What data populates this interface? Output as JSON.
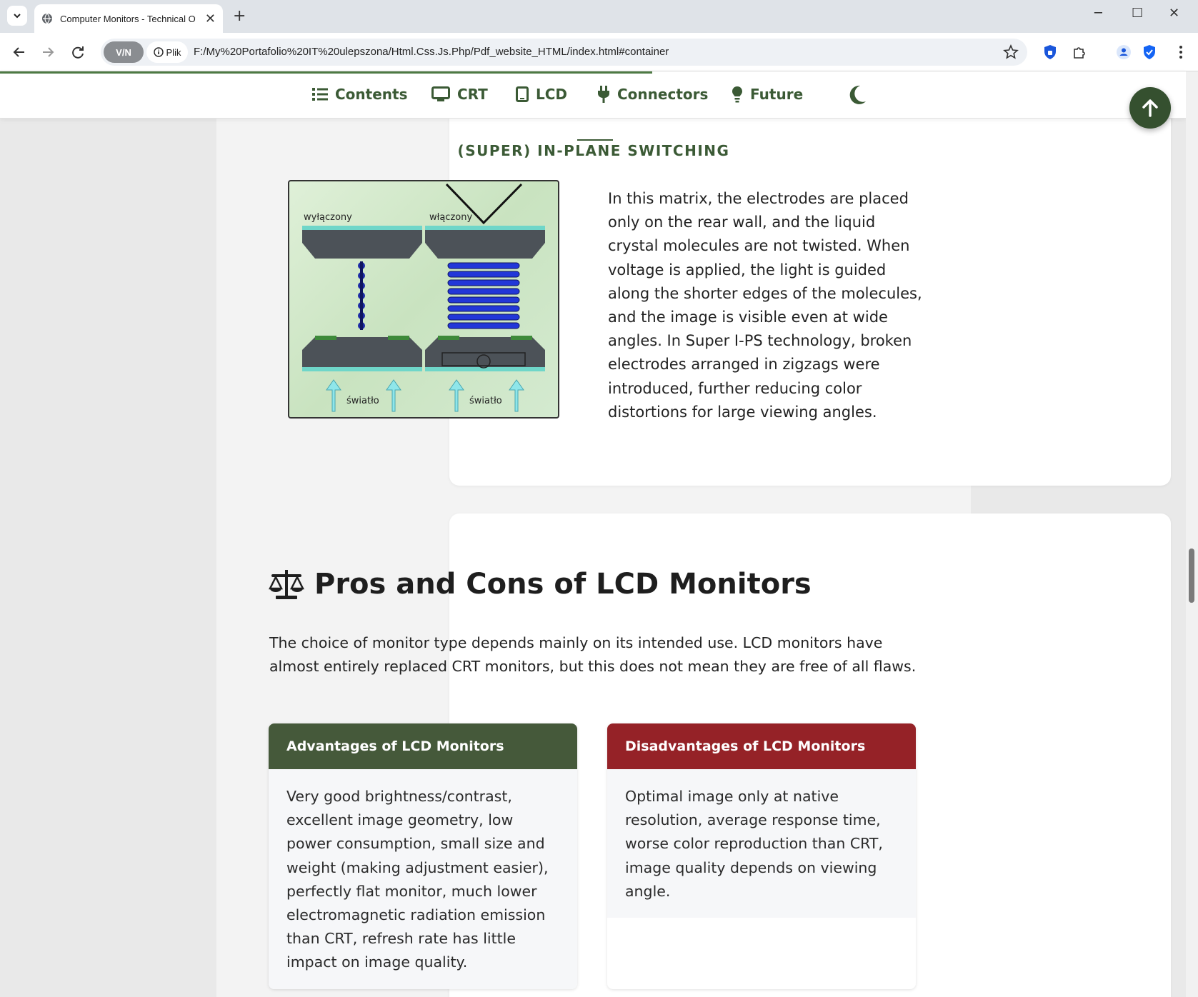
{
  "browser": {
    "tab_title": "Computer Monitors - Technical Ov",
    "vpn_label": "V/N",
    "site_info_label": "Plik",
    "url": "F:/My%20Portafolio%20IT%20ulepszona/Html.Css.Js.Php/Pdf_website_HTML/index.html#container",
    "icons": [
      "tab-list-icon",
      "globe-icon",
      "close-icon",
      "plus-icon",
      "minimize-icon",
      "maximize-icon",
      "close-window-icon",
      "back-icon",
      "forward-icon",
      "reload-icon",
      "info-icon",
      "star-icon",
      "shield-icon",
      "puzzle-icon",
      "profile-icon",
      "check-shield-icon",
      "menu-icon"
    ]
  },
  "nav": {
    "items": [
      {
        "label": "Contents",
        "icon": "list-icon"
      },
      {
        "label": "CRT",
        "icon": "monitor-icon"
      },
      {
        "label": "LCD",
        "icon": "tablet-icon"
      },
      {
        "label": "Connectors",
        "icon": "plug-icon"
      },
      {
        "label": "Future",
        "icon": "lightbulb-icon"
      }
    ],
    "theme_toggle_icon": "moon-icon",
    "back_to_top_icon": "arrow-up-icon",
    "accent_color": "#3b5a35",
    "reading_progress": 0.55
  },
  "ips": {
    "title": "(SUPER) IN-PLANE SWITCHING",
    "figure_labels": {
      "off": "wyłączony",
      "on": "włączony",
      "light_left": "światło",
      "light_right": "światło"
    },
    "description": "In this matrix, the electrodes are placed only on the rear wall, and the liquid crystal molecules are not twisted. When voltage is applied, the light is guided along the shorter edges of the molecules, and the image is visible even at wide angles. In Super I-PS technology, broken electrodes arranged in zigzags were introduced, further reducing color distortions for large viewing angles."
  },
  "pros_cons": {
    "heading": "Pros and Cons of LCD Monitors",
    "heading_icon": "scale-icon",
    "intro": "The choice of monitor type depends mainly on its intended use. LCD monitors have almost entirely replaced CRT monitors, but this does not mean they are free of all flaws.",
    "advantages": {
      "title": "Advantages of LCD Monitors",
      "color": "#45593a",
      "text": "Very good brightness/contrast, excellent image geometry, low power consumption, small size and weight (making adjustment easier), perfectly flat monitor, much lower electromagnetic radiation emission than CRT, refresh rate has little impact on image quality."
    },
    "disadvantages": {
      "title": "Disadvantages of LCD Monitors",
      "color": "#952227",
      "text": "Optimal image only at native resolution, average response time, worse color reproduction than CRT, image quality depends on viewing angle."
    }
  }
}
